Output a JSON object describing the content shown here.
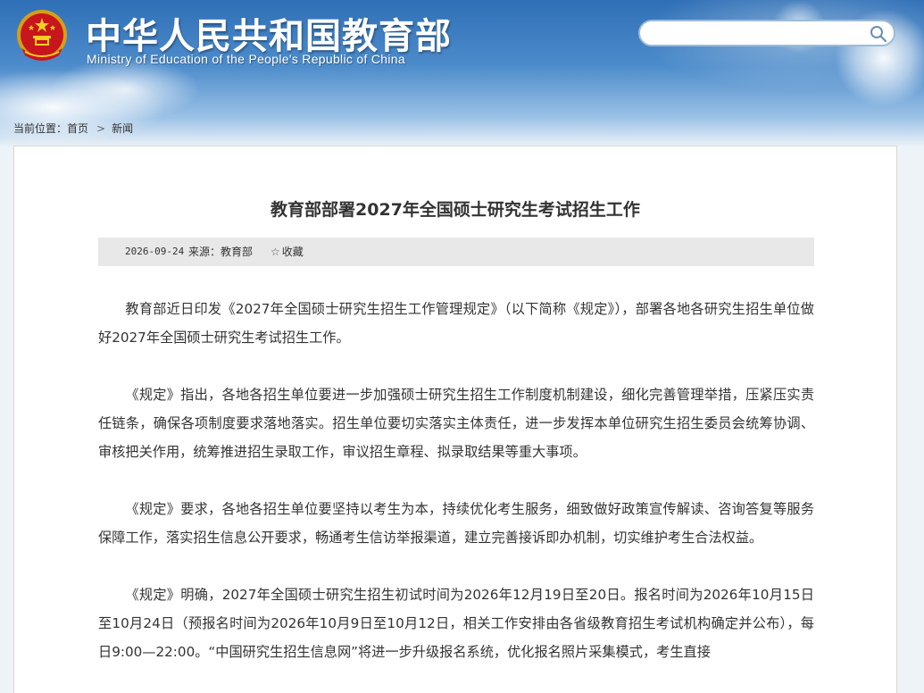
{
  "header": {
    "title_cn": "中华人民共和国教育部",
    "title_en": "Ministry of Education of the People's Republic of China",
    "search_placeholder": ""
  },
  "breadcrumb": {
    "prefix": "当前位置：",
    "home": "首页",
    "separator": ">",
    "current": "新闻"
  },
  "article": {
    "title": "教育部部署2027年全国硕士研究生考试招生工作",
    "date": "2026-09-24",
    "source": "来源：教育部",
    "favorite_label": "收藏",
    "paragraphs": [
      "教育部近日印发《2027年全国硕士研究生招生工作管理规定》（以下简称《规定》），部署各地各研究生招生单位做好2027年全国硕士研究生考试招生工作。",
      "《规定》指出，各地各招生单位要进一步加强硕士研究生招生工作制度机制建设，细化完善管理举措，压紧压实责任链条，确保各项制度要求落地落实。招生单位要切实落实主体责任，进一步发挥本单位研究生招生委员会统筹协调、审核把关作用，统筹推进招生录取工作，审议招生章程、拟录取结果等重大事项。",
      "《规定》要求，各地各招生单位要坚持以考生为本，持续优化考生服务，细致做好政策宣传解读、咨询答复等服务保障工作，落实招生信息公开要求，畅通考生信访举报渠道，建立完善接诉即办机制，切实维护考生合法权益。",
      "《规定》明确，2027年全国硕士研究生招生初试时间为2026年12月19日至20日。报名时间为2026年10月15日至10月24日（预报名时间为2026年10月9日至10月12日，相关工作安排由各省级教育招生考试机构确定并公布），每日9:00—22:00。“中国研究生招生信息网”将进一步升级报名系统，优化报名照片采集模式，考生直接"
    ]
  },
  "colors": {
    "header_blue": "#2f6fb6",
    "meta_bar_bg": "#e8e8e8",
    "text": "#333333"
  },
  "icons": {
    "emblem": "national-emblem-icon",
    "search": "search-icon",
    "favorite": "star-outline-icon"
  }
}
